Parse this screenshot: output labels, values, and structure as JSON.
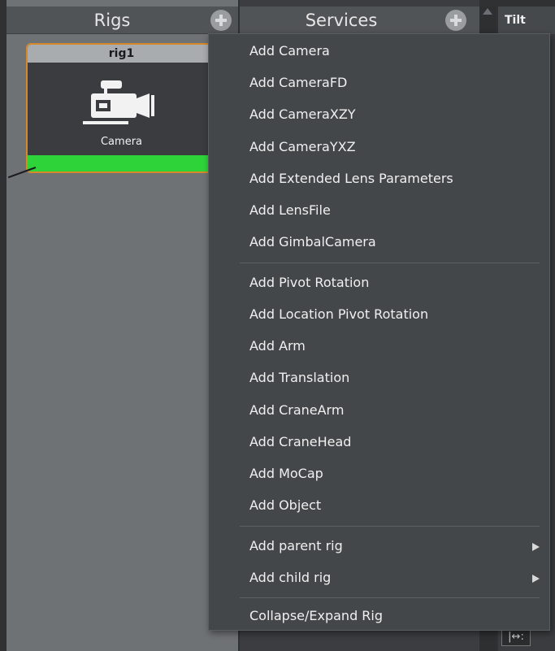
{
  "rigs_panel": {
    "title": "Rigs",
    "rig": {
      "name": "rig1",
      "component_label": "Camera",
      "status_color": "#2ed33a",
      "border_color": "#d6892b"
    }
  },
  "services_panel": {
    "title": "Services"
  },
  "tilt_column": {
    "header": "Tilt",
    "bottom_icon_text": "|↔:"
  },
  "context_menu": {
    "group1": [
      "Add Camera",
      "Add CameraFD",
      "Add CameraXZY",
      "Add CameraYXZ",
      "Add Extended Lens Parameters",
      "Add LensFile",
      "Add GimbalCamera"
    ],
    "group2": [
      "Add Pivot Rotation",
      "Add Location Pivot Rotation",
      "Add Arm",
      "Add Translation",
      "Add CraneArm",
      "Add CraneHead",
      "Add MoCap",
      "Add Object"
    ],
    "group3": [
      "Add parent rig",
      "Add child rig"
    ],
    "group4": [
      "Collapse/Expand Rig"
    ]
  },
  "icons": {
    "rigs_add": "plus-circle-icon",
    "services_add": "plus-circle-icon",
    "camera": "video-camera-icon",
    "submenu": "triangle-right-icon",
    "scroll_up": "triangle-up-icon"
  }
}
